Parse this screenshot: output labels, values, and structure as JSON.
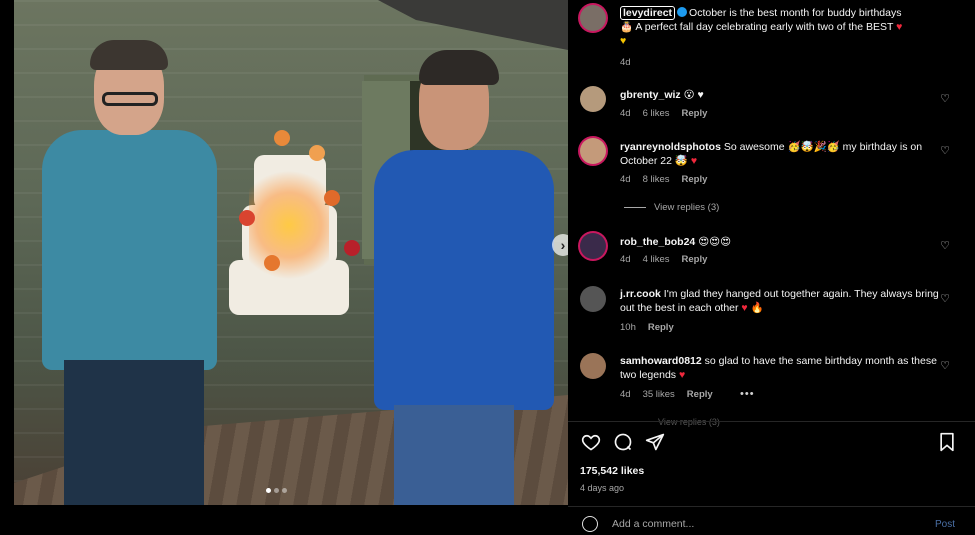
{
  "post": {
    "author": "levydirect",
    "caption_line1": "October is the best month for buddy birthdays",
    "caption_line2": "A perfect fall day celebrating early with two of the BEST",
    "caption_emoji_cake": "🎂",
    "caption_emoji_heart": "♥",
    "caption_emoji_yellow_heart": "♥",
    "age": "4d"
  },
  "comments": [
    {
      "user": "gbrenty_wiz",
      "text": "😮 ♥",
      "age": "4d",
      "likes": "6 likes",
      "reply": "Reply"
    },
    {
      "user": "ryanreynoldsphotos",
      "text": "So awesome 🥳🤯🎉🥳 my birthday is on October 22 🤯",
      "heart": "♥",
      "age": "4d",
      "likes": "8 likes",
      "reply": "Reply"
    },
    {
      "user": "rob_the_bob24",
      "text": "😍😍😍",
      "age": "4d",
      "likes": "4 likes",
      "reply": "Reply"
    },
    {
      "user": "j.rr.cook",
      "text": "I'm glad they hanged out together again. They always bring out the best in each other",
      "heart": "♥",
      "extra": "🔥",
      "age": "10h",
      "reply": "Reply"
    },
    {
      "user": "samhoward0812",
      "text": "so glad to have the same birthday month as these two legends",
      "heart": "♥",
      "age": "4d",
      "likes": "35 likes",
      "reply": "Reply",
      "more": "•••"
    }
  ],
  "view_replies": "View replies (3)",
  "faded_row": "View replies (3)",
  "stats": {
    "likes": "175,542 likes",
    "posted": "4 days ago"
  },
  "comment_box": {
    "placeholder": "Add a comment...",
    "post": "Post"
  },
  "icons": {
    "like": "heart-outline-icon",
    "comment": "comment-bubble-icon",
    "share": "paper-plane-icon",
    "save": "bookmark-icon",
    "emoji": "smiley-icon",
    "next": "chevron-right-icon"
  },
  "carousel": {
    "total": 3,
    "active": 1
  },
  "colors": {
    "verified": "#1d9bf0",
    "heart": "#f0283c",
    "story_ring": "#c8185f",
    "post_link": "#4a6fa5"
  }
}
